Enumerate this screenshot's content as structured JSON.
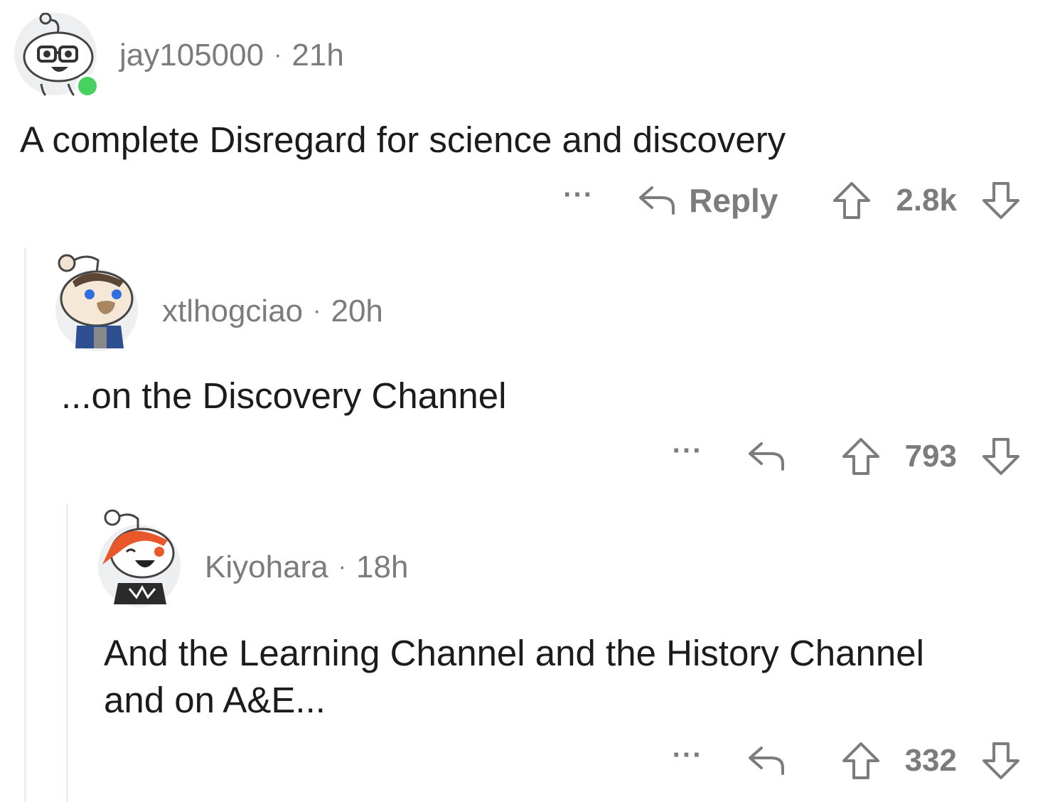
{
  "comments": [
    {
      "username": "jay105000",
      "separator": "·",
      "age": "21h",
      "text": "A complete Disregard for science and discovery",
      "reply_label": "Reply",
      "more_label": "···",
      "score": "2.8k",
      "online": true
    },
    {
      "username": "xtlhogciao",
      "separator": "·",
      "age": "20h",
      "text": "...on the Discovery Channel",
      "more_label": "···",
      "score": "793"
    },
    {
      "username": "Kiyohara",
      "separator": "·",
      "age": "18h",
      "text_line1": "And the Learning Channel and the History Channel",
      "text_line2": "and on A&E...",
      "more_label": "···",
      "score": "332"
    }
  ],
  "icons": {
    "reply": "reply-arrow-icon",
    "upvote": "upvote-arrow-icon",
    "downvote": "downvote-arrow-icon",
    "more": "more-dots-icon"
  },
  "colors": {
    "meta_text": "#7c7c7c",
    "body_text": "#1c1c1c",
    "thread_line": "#edeff1",
    "online_badge": "#46d160"
  }
}
